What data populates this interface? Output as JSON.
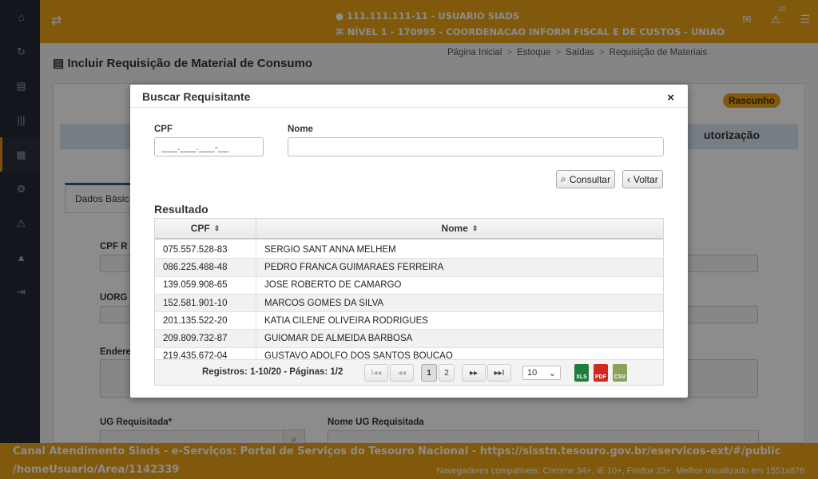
{
  "topbar": {
    "user_line": "111.111.111-11 - USUARIO SIADS",
    "level_line": "NÍVEL 1 - 170995 - COORDENACAO INFORM FISCAL E DE CUSTOS - UNIAO",
    "notification_count": "10"
  },
  "page": {
    "title": "Incluir Requisição de Material de Consumo",
    "breadcrumbs": [
      "Página Inicial",
      "Estoque",
      "Saídas",
      "Requisição de Materiais"
    ],
    "status_badge": "Rascunho",
    "step_label": "utorização",
    "tab_label": "Dados Básic",
    "fields": {
      "cpf_label": "CPF R",
      "uorg_label": "UORG",
      "endereco_label": "Endere",
      "ug_label": "UG Requisitada*",
      "nome_ug_label": "Nome UG Requisitada"
    }
  },
  "modal": {
    "title": "Buscar Requisitante",
    "close": "×",
    "cpf_label": "CPF",
    "cpf_placeholder": "___.___.___-__",
    "nome_label": "Nome",
    "nome_value": "",
    "consultar_label": "Consultar",
    "voltar_label": "Voltar",
    "result_title": "Resultado",
    "table": {
      "columns": [
        "CPF",
        "Nome"
      ],
      "rows": [
        {
          "cpf": "075.557.528-83",
          "nome": "SERGIO SANT ANNA MELHEM"
        },
        {
          "cpf": "086.225.488-48",
          "nome": "PEDRO FRANCA GUIMARAES FERREIRA"
        },
        {
          "cpf": "139.059.908-65",
          "nome": "JOSE ROBERTO DE CAMARGO"
        },
        {
          "cpf": "152.581.901-10",
          "nome": "MARCOS GOMES DA SILVA"
        },
        {
          "cpf": "201.135.522-20",
          "nome": "KATIA CILENE OLIVEIRA RODRIGUES"
        },
        {
          "cpf": "209.809.732-87",
          "nome": "GUIOMAR DE ALMEIDA BARBOSA"
        },
        {
          "cpf": "219.435.672-04",
          "nome": "GUSTAVO ADOLFO DOS SANTOS BOUCAO"
        }
      ]
    },
    "pager": {
      "summary": "Registros: 1-10/20 - Páginas: 1/2",
      "first": "I◂◂",
      "prev": "◂◂",
      "pages": [
        "1",
        "2"
      ],
      "next": "▸▸",
      "last": "▸▸I",
      "page_size": "10",
      "export_xls": "XLS",
      "export_pdf": "PDF",
      "export_csv": "CSV"
    }
  },
  "footer": {
    "line1": "Canal Atendimento Siads - e-Serviços: Portal de Serviços do Tesouro Nacional - https://sisstn.tesouro.gov.br/eservicos-ext/#/public",
    "line2": "/homeUsuario/Area/1142339",
    "note": "Navegadores compatíveis: Chrome 34+, IE 10+, Firefox 23+. Melhor visualizado em 1551x876."
  },
  "colors": {
    "accent": "#e9a318",
    "sidebar": "#232834",
    "overlay": "rgba(0,0,0,0.45)"
  }
}
